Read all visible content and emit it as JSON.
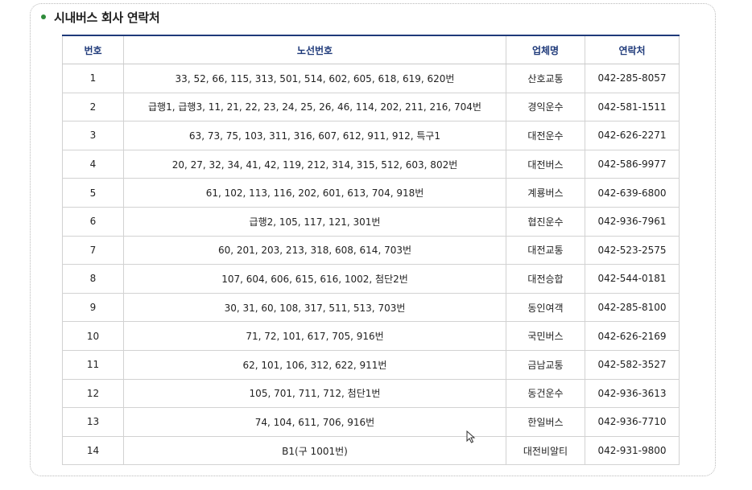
{
  "section": {
    "title": "시내버스 회사 연락처"
  },
  "table": {
    "headers": {
      "no": "번호",
      "route": "노선번호",
      "company": "업체명",
      "phone": "연락처"
    },
    "rows": [
      {
        "no": "1",
        "route": "33, 52, 66, 115, 313, 501, 514, 602, 605, 618, 619, 620번",
        "company": "산호교통",
        "phone": "042-285-8057"
      },
      {
        "no": "2",
        "route": "급행1, 급행3, 11, 21, 22, 23, 24, 25, 26, 46, 114, 202, 211, 216, 704번",
        "company": "경익운수",
        "phone": "042-581-1511"
      },
      {
        "no": "3",
        "route": "63, 73, 75, 103, 311, 316, 607, 612, 911, 912, 특구1",
        "company": "대전운수",
        "phone": "042-626-2271"
      },
      {
        "no": "4",
        "route": "20, 27, 32, 34, 41, 42, 119, 212, 314, 315, 512, 603, 802번",
        "company": "대전버스",
        "phone": "042-586-9977"
      },
      {
        "no": "5",
        "route": "61, 102, 113, 116, 202, 601, 613, 704, 918번",
        "company": "계룡버스",
        "phone": "042-639-6800"
      },
      {
        "no": "6",
        "route": "급행2, 105, 117, 121, 301번",
        "company": "협진운수",
        "phone": "042-936-7961"
      },
      {
        "no": "7",
        "route": "60, 201, 203, 213, 318, 608, 614, 703번",
        "company": "대전교통",
        "phone": "042-523-2575"
      },
      {
        "no": "8",
        "route": "107, 604, 606, 615, 616, 1002, 첨단2번",
        "company": "대전승합",
        "phone": "042-544-0181"
      },
      {
        "no": "9",
        "route": "30, 31, 60, 108, 317, 511, 513, 703번",
        "company": "동인여객",
        "phone": "042-285-8100"
      },
      {
        "no": "10",
        "route": "71, 72, 101, 617, 705, 916번",
        "company": "국민버스",
        "phone": "042-626-2169"
      },
      {
        "no": "11",
        "route": "62, 101, 106, 312, 622, 911번",
        "company": "금남교통",
        "phone": "042-582-3527"
      },
      {
        "no": "12",
        "route": "105, 701, 711, 712, 첨단1번",
        "company": "동건운수",
        "phone": "042-936-3613"
      },
      {
        "no": "13",
        "route": "74, 104, 611, 706, 916번",
        "company": "한일버스",
        "phone": "042-936-7710"
      },
      {
        "no": "14",
        "route": "B1(구 1001번)",
        "company": "대전비알티",
        "phone": "042-931-9800"
      }
    ]
  },
  "colors": {
    "header_text": "#1f3a7a",
    "bullet": "#2e8b3a"
  },
  "icons": {
    "bullet": "dot-icon",
    "cursor": "mouse-pointer-icon"
  }
}
